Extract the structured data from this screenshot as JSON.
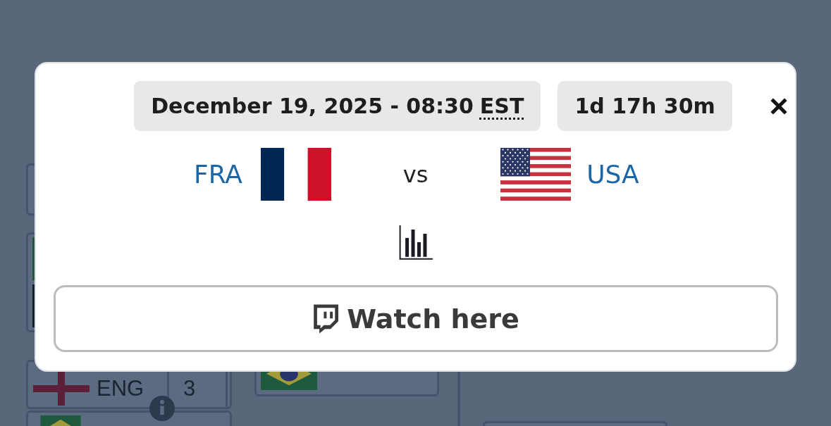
{
  "background_bracket": {
    "rows": [
      {
        "team": "ENG",
        "score": "3",
        "kind": "england"
      }
    ]
  },
  "match_popup": {
    "date": "December 19, 2025 - 08:30",
    "timezone": "EST",
    "countdown": "1d 17h 30m",
    "teams": [
      {
        "code": "FRA",
        "kind": "france"
      },
      {
        "code": "USA",
        "kind": "usa"
      }
    ],
    "versus": "vs",
    "watch_button": {
      "label": "Watch here"
    }
  }
}
